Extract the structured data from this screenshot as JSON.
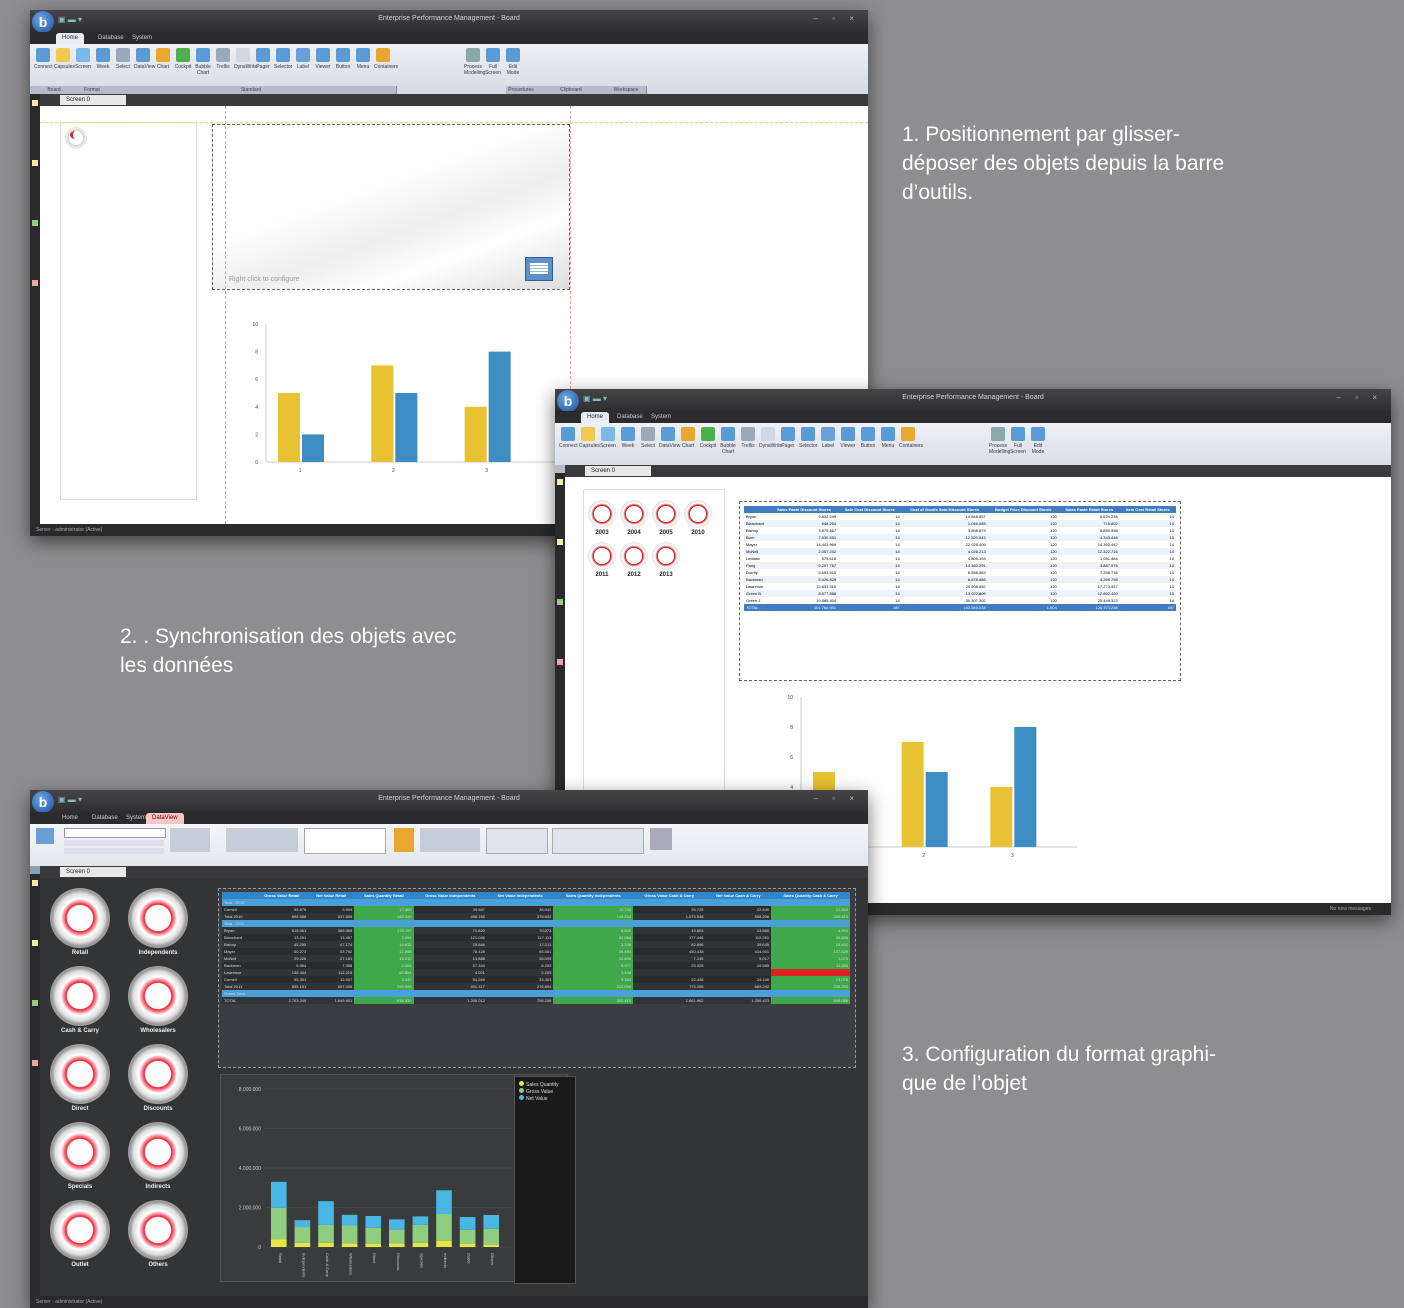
{
  "captions": {
    "c1": "1.  Positionnement par glisser-\ndéposer des objets depuis la barre\nd’outils.",
    "c2": "2. . Synchronisation des objets avec\nles données",
    "c3": "3. Configuration du format graphi-\nque de l’objet"
  },
  "app": {
    "title": "Enterprise Performance Management - Board",
    "tabs": [
      "Home",
      "Database",
      "System"
    ],
    "ribbon_buttons": [
      "Connect",
      "Capsules",
      "Screen",
      "Week",
      "Select",
      "DataView",
      "Chart",
      "Cockpit",
      "Bubble Chart",
      "Trellis",
      "DynaWrite",
      "Pager",
      "Selector",
      "Label",
      "Viewer",
      "Button",
      "Menu",
      "Containers",
      "Process Modelling",
      "Full Screen",
      "Edit Mode"
    ],
    "ribbon_groups": [
      "Board",
      "Format",
      "Standard",
      "Procedures",
      "Clipboard",
      "Workspace"
    ],
    "side_items": [
      "Menu",
      "Cart",
      "Layout",
      "Search"
    ],
    "screen_tab": "Screen 0",
    "placeholder_text": "Right click to configure",
    "status_text": "Server - administrator (Active)",
    "status_right": "No new messages"
  },
  "win1": {
    "chart_data": {
      "type": "bar",
      "categories": [
        "1",
        "2",
        "3"
      ],
      "series": [
        {
          "values": [
            5,
            7,
            4
          ],
          "color": "#e8c232"
        },
        {
          "values": [
            2,
            5,
            8
          ],
          "color": "#3d8dc4"
        }
      ],
      "yticks": [
        "0",
        "2",
        "4",
        "6",
        "8",
        "10"
      ],
      "ylim": [
        0,
        10
      ]
    }
  },
  "win2": {
    "gauges": [
      "2003",
      "2004",
      "2005",
      "2010",
      "2011",
      "2012",
      "2013"
    ],
    "table": {
      "headers": [
        "",
        "Sales Paste Discount Stores",
        "Sale Cost Discount Stores",
        "Cost of Goods Sold Discount Stores",
        "Budget Price Discount Stores",
        "Sales Paste Retail Stores",
        "Item Cost Retail Stores"
      ],
      "rows": [
        [
          "Bryan",
          "9.832.249",
          "14",
          "14.848.857",
          "120",
          "8.624.238",
          "14"
        ],
        [
          "Blanchard",
          "648.254",
          "14",
          "1.046.085",
          "120",
          "715.802",
          "14"
        ],
        [
          "Bishop",
          "3.879.867",
          "14",
          "3.898.879",
          "120",
          "8.850.998",
          "14"
        ],
        [
          "Burn",
          "7.630.551",
          "14",
          "12.520.043",
          "120",
          "4.343.448",
          "14"
        ],
        [
          "Mayer",
          "14.441.969",
          "14",
          "22.028.409",
          "120",
          "14.392.442",
          "14"
        ],
        [
          "McNeil",
          "2.057.202",
          "14",
          "4.026.213",
          "120",
          "12.322.716",
          "14"
        ],
        [
          "Leblanc",
          "575.618",
          "14",
          "4.809.194",
          "120",
          "1.051.484",
          "14"
        ],
        [
          "Pang",
          "9.297.767",
          "14",
          "14.460.291",
          "120",
          "3.887.976",
          "14"
        ],
        [
          "Dorrity",
          "5.693.515",
          "14",
          "6.558.583",
          "120",
          "7.258.735",
          "14"
        ],
        [
          "Backman",
          "5.426.829",
          "14",
          "8.878.886",
          "120",
          "4.269.798",
          "14"
        ],
        [
          "Lawrence",
          "12.633.319",
          "14",
          "20.508.692",
          "120",
          "17.273.957",
          "14"
        ],
        [
          "Green B.",
          "8.677.888",
          "14",
          "13.922.809",
          "120",
          "12.892.420",
          "14"
        ],
        [
          "Green J.",
          "19.885.404",
          "14",
          "30.307.302",
          "120",
          "25.449.323",
          "14"
        ],
        [
          "TOTAL",
          "101.766.951",
          "187",
          "163.545.034",
          "1.604",
          "128.373.238",
          "187"
        ]
      ]
    },
    "chart_data": {
      "type": "bar",
      "categories": [
        "1",
        "2",
        "3"
      ],
      "series": [
        {
          "values": [
            5,
            7,
            4
          ],
          "color": "#e8c232"
        },
        {
          "values": [
            2,
            5,
            8
          ],
          "color": "#3d8dc4"
        }
      ],
      "yticks": [
        "4",
        "6",
        "8",
        "10"
      ],
      "ylim": [
        0,
        10
      ]
    }
  },
  "win3": {
    "tabs": [
      "Home",
      "Database",
      "System",
      "DataView"
    ],
    "gauges": [
      "Retail",
      "Independents",
      "Cash & Carry",
      "Wholesalers",
      "Direct",
      "Discounts",
      "Specials",
      "Indirects",
      "Outlet",
      "Others"
    ],
    "table": {
      "headers": [
        "",
        "Gross Value Retail",
        "Net Value Retail",
        "Sales Quantity Retail",
        "Gross Value Independents",
        "Net Value Independents",
        "Sales Quantity Independents",
        "Gross Value Cash & Carry",
        "Net Value Cash & Carry",
        "Sales Quantity Cash & Carry"
      ],
      "rows": [
        [
          "Year : 2010",
          "",
          "",
          "",
          "",
          "",
          "",
          "",
          "",
          ""
        ],
        [
          "Cornell",
          "55.675",
          "9.509",
          "17.400",
          "39.587",
          "38.042",
          "12.732",
          "35.725",
          "22.640",
          "12.849"
        ],
        [
          "Total 2010",
          "898.588",
          "537.509",
          "182.349",
          "458.155",
          "375.932",
          "149.254",
          "1.073.948",
          "558.206",
          "290.813"
        ],
        [
          "Year : 2011",
          "",
          "",
          "",
          "",
          "",
          "",
          "",
          "",
          ""
        ],
        [
          "Bryan",
          "515.061",
          "385.069",
          "178.197",
          "71.620",
          "70.073",
          "5.829",
          "13.803",
          "13.560",
          "4.994"
        ],
        [
          "Blanchard",
          "13.291",
          "13.467",
          "3.094",
          "121.046",
          "117.113",
          "62.064",
          "177.446",
          "119.261",
          "30.826"
        ],
        [
          "Bishop",
          "45.290",
          "47.174",
          "19.932",
          "25.846",
          "17.211",
          "3.326",
          "82.896",
          "39.645",
          "15.432"
        ],
        [
          "Mayer",
          "50.273",
          "53.752",
          "17.098",
          "78.428",
          "65.081",
          "29.494",
          "450.438",
          "414.931",
          "137.629"
        ],
        [
          "McNeil",
          "29.026",
          "27.181",
          "19.232",
          "13.888",
          "36.099",
          "12.609",
          "7.146",
          "5.017",
          "1.075"
        ],
        [
          "Backman",
          "5.964",
          "7.398",
          "2.504",
          "57.344",
          "8.293",
          "5.977",
          "23.925",
          "19.585",
          "11.289"
        ],
        [
          "Lawrence",
          "138.444",
          "112.215",
          "60.854",
          "4.021",
          "2.253",
          "1.448",
          "",
          "",
          ""
        ],
        [
          "Cornell",
          "55.301",
          "12.007",
          "5.332",
          "54.269",
          "33.383",
          "5.354",
          "22.436",
          "24.140",
          "14.076"
        ],
        [
          "Total 2011",
          "855.151",
          "657.436",
          "299.998",
          "491.317",
          "276.894",
          "212.094",
          "775.285",
          "689.242",
          "235.254"
        ],
        [
          "Grand Total",
          "",
          "",
          "",
          "",
          "",
          "",
          "",
          "",
          ""
        ],
        [
          "TOTAL",
          "2.763.249",
          "1.649.801",
          "616.930",
          "1.208.012",
          "708.288",
          "392.415",
          "1.861.962",
          "1.356.423",
          "546.066"
        ]
      ]
    },
    "chart_data": {
      "type": "bar",
      "categories": [
        "Retail",
        "Independents",
        "Cash & Carry",
        "Wholesalers",
        "Direct",
        "Discounts",
        "Specials",
        "Indirects",
        "Outlet",
        "Others"
      ],
      "series": [
        {
          "name": "Sales Quantity",
          "values": [
            380000,
            210000,
            220000,
            190000,
            170000,
            180000,
            220000,
            320000,
            170000,
            120000
          ],
          "color": "#e6e645"
        },
        {
          "name": "Gross Value",
          "values": [
            1600000,
            800000,
            900000,
            900000,
            800000,
            700000,
            900000,
            1350000,
            700000,
            800000
          ],
          "color": "#8fce7e"
        },
        {
          "name": "Net Value",
          "values": [
            1320000,
            350000,
            1200000,
            540000,
            600000,
            520000,
            430000,
            1200000,
            650000,
            700000
          ],
          "color": "#49b6e3"
        }
      ],
      "yticks": [
        "0",
        "2.000.000",
        "4.000.000",
        "6.000.000",
        "8.000.000"
      ],
      "ylim": [
        0,
        8000000
      ]
    }
  }
}
